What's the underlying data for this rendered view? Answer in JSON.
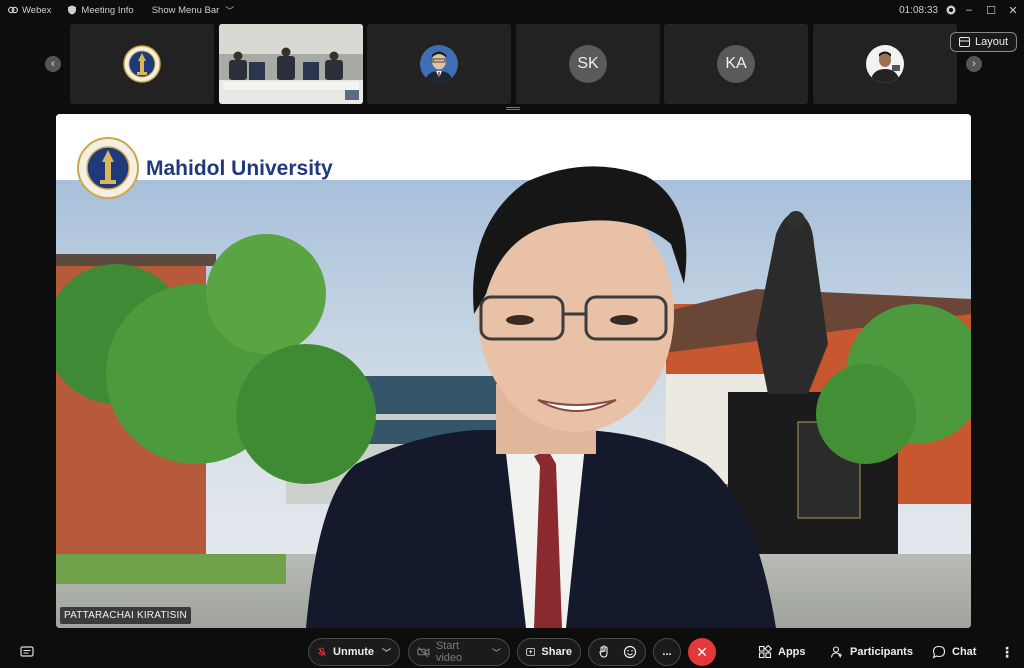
{
  "titlebar": {
    "app_name": "Webex",
    "meeting_info": "Meeting Info",
    "show_menu_bar": "Show Menu Bar",
    "timer": "01:08:33"
  },
  "strip": {
    "layout_label": "Layout",
    "thumbnails": [
      {
        "kind": "logo"
      },
      {
        "kind": "room"
      },
      {
        "kind": "photo"
      },
      {
        "kind": "initials",
        "initials": "SK"
      },
      {
        "kind": "initials",
        "initials": "KA"
      },
      {
        "kind": "photo2"
      }
    ]
  },
  "stage": {
    "speaker_name": "PATTARACHAI KIRATISIN",
    "background_brand": "Mahidol University"
  },
  "toolbar": {
    "unmute": "Unmute",
    "start_video": "Start video",
    "share": "Share",
    "more": "...",
    "apps": "Apps",
    "participants": "Participants",
    "chat": "Chat"
  },
  "colors": {
    "end_call": "#e5383b",
    "background": "#0d0d0d",
    "mahidol_blue": "#1f3a7a"
  }
}
